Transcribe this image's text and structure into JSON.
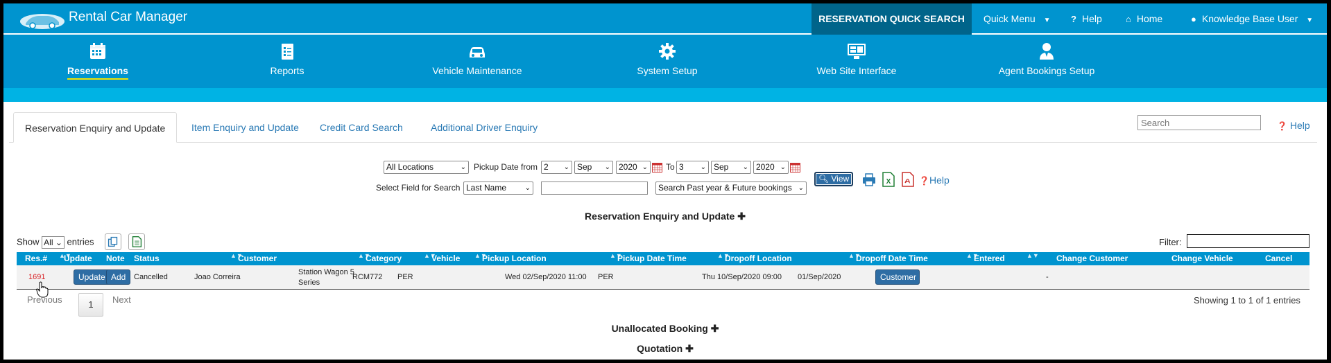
{
  "app": {
    "title": "Rental Car Manager"
  },
  "topnav": {
    "quick_search": "RESERVATION QUICK SEARCH",
    "quick_menu": "Quick Menu",
    "help": "Help",
    "home": "Home",
    "user": "Knowledge Base User"
  },
  "modules": [
    {
      "label": "Reservations",
      "icon": "calendar-icon",
      "active": true
    },
    {
      "label": "Reports",
      "icon": "checklist-icon"
    },
    {
      "label": "Vehicle Maintenance",
      "icon": "car-icon"
    },
    {
      "label": "System Setup",
      "icon": "gear-icon"
    },
    {
      "label": "Web Site Interface",
      "icon": "monitor-icon"
    },
    {
      "label": "Agent Bookings Setup",
      "icon": "agent-icon"
    }
  ],
  "tabs": [
    {
      "label": "Reservation Enquiry and Update",
      "active": true
    },
    {
      "label": "Item Enquiry and Update"
    },
    {
      "label": "Credit Card Search"
    },
    {
      "label": "Additional Driver Enquiry"
    }
  ],
  "search": {
    "placeholder": "Search"
  },
  "help_label": "Help",
  "filters": {
    "location": "All Locations",
    "pickup_label": "Pickup Date from",
    "from_day": "2",
    "from_month": "Sep",
    "from_year": "2020",
    "to_label": "To",
    "to_day": "3",
    "to_month": "Sep",
    "to_year": "2020",
    "field_label": "Select Field for Search",
    "field": "Last Name",
    "search_value": "",
    "scope": "Search Past year & Future bookings",
    "view_label": "View",
    "help_label": "Help"
  },
  "sections": {
    "main": "Reservation Enquiry and Update",
    "unallocated": "Unallocated Booking",
    "quotation": "Quotation"
  },
  "table_controls": {
    "show_label": "Show",
    "entries_value": "All",
    "entries_label": "entries",
    "filter_label": "Filter:"
  },
  "table": {
    "headers": [
      "Res.#",
      "Update",
      "Note",
      "Status",
      "Customer",
      "Category",
      "Vehicle",
      "Pickup Location",
      "Pickup Date Time",
      "Dropoff Location",
      "Dropoff Date Time",
      "Entered",
      "Change Customer",
      "Change Vehicle",
      "Cancel"
    ],
    "rows": [
      {
        "res_no": "1691",
        "update": "Update",
        "note": "Add",
        "status": "Cancelled",
        "customer": "Joao Correira",
        "category": "Station Wagon 5 Series",
        "vehicle": "RCM772",
        "pickup_location": "PER",
        "pickup_datetime": "Wed 02/Sep/2020 11:00",
        "dropoff_location": "PER",
        "dropoff_datetime": "Thu 10/Sep/2020 09:00",
        "entered": "01/Sep/2020",
        "change_customer": "Customer",
        "change_vehicle": "",
        "cancel": "-"
      }
    ]
  },
  "pager": {
    "previous": "Previous",
    "page": "1",
    "next": "Next",
    "showing": "Showing 1 to 1 of 1 entries"
  },
  "colors": {
    "primary": "#0094cf",
    "dark": "#00648a",
    "stripe": "#00b3e4",
    "button": "#2e6da4",
    "link": "#2a7ab5",
    "accent": "#f5e400"
  }
}
